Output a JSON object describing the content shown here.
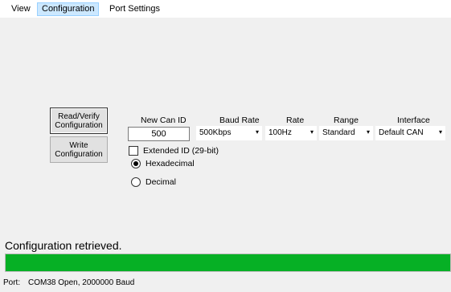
{
  "menu": {
    "items": [
      {
        "label": "View",
        "active": false
      },
      {
        "label": "Configuration",
        "active": true
      },
      {
        "label": "Port Settings",
        "active": false
      }
    ]
  },
  "buttons": {
    "read_verify": "Read/Verify Configuration",
    "write": "Write Configuration"
  },
  "form": {
    "can_id": {
      "label": "New Can ID",
      "value": "500"
    },
    "baud_rate": {
      "label": "Baud Rate",
      "value": "500Kbps"
    },
    "rate": {
      "label": "Rate",
      "value": "100Hz"
    },
    "range": {
      "label": "Range",
      "value": "Standard"
    },
    "interface": {
      "label": "Interface",
      "value": "Default CAN"
    },
    "extended_id": {
      "label": "Extended ID (29-bit)",
      "checked": false
    },
    "format": {
      "hex_label": "Hexadecimal",
      "dec_label": "Decimal",
      "selected": "Hexadecimal"
    }
  },
  "status": {
    "message": "Configuration retrieved.",
    "progress_percent": 100,
    "progress_color": "#06b025"
  },
  "statusbar": {
    "port_label": "Port:",
    "port_value": "COM38 Open, 2000000 Baud"
  },
  "icons": {
    "dropdown": "▾"
  }
}
